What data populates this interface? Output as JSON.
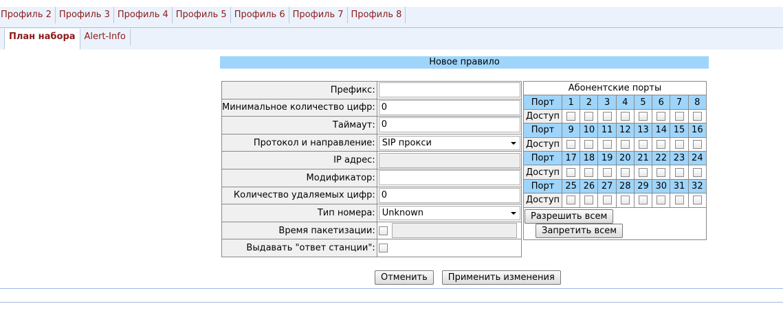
{
  "profile_tabs": [
    "Профиль 2",
    "Профиль 3",
    "Профиль 4",
    "Профиль 5",
    "Профиль 6",
    "Профиль 7",
    "Профиль 8"
  ],
  "sub_tabs": {
    "active": "План набора",
    "other": "Alert-Info"
  },
  "section_title": "Новое правило",
  "form": {
    "prefix_label": "Префикс:",
    "prefix_value": "",
    "min_digits_label": "Минимальное количество цифр:",
    "min_digits_value": "0",
    "timeout_label": "Таймаут:",
    "timeout_value": "0",
    "protocol_label": "Протокол и направление:",
    "protocol_value": "SIP прокси",
    "ip_label": "IP адрес:",
    "ip_value": "",
    "modifier_label": "Модификатор:",
    "modifier_value": "",
    "deleted_digits_label": "Количество удаляемых цифр:",
    "deleted_digits_value": "0",
    "number_type_label": "Тип номера:",
    "number_type_value": "Unknown",
    "packet_time_label": "Время пакетизации:",
    "packet_time_value": "",
    "station_answer_label": "Выдавать \"ответ станции\":"
  },
  "ports": {
    "title": "Абонентские порты",
    "port_label": "Порт",
    "access_label": "Доступ",
    "groups": [
      [
        "1",
        "2",
        "3",
        "4",
        "5",
        "6",
        "7",
        "8"
      ],
      [
        "9",
        "10",
        "11",
        "12",
        "13",
        "14",
        "15",
        "16"
      ],
      [
        "17",
        "18",
        "19",
        "20",
        "21",
        "22",
        "23",
        "24"
      ],
      [
        "25",
        "26",
        "27",
        "28",
        "29",
        "30",
        "31",
        "32"
      ]
    ],
    "allow_all": "Разрешить всем",
    "deny_all": "Запретить всем"
  },
  "actions": {
    "cancel": "Отменить",
    "apply": "Применить изменения"
  }
}
